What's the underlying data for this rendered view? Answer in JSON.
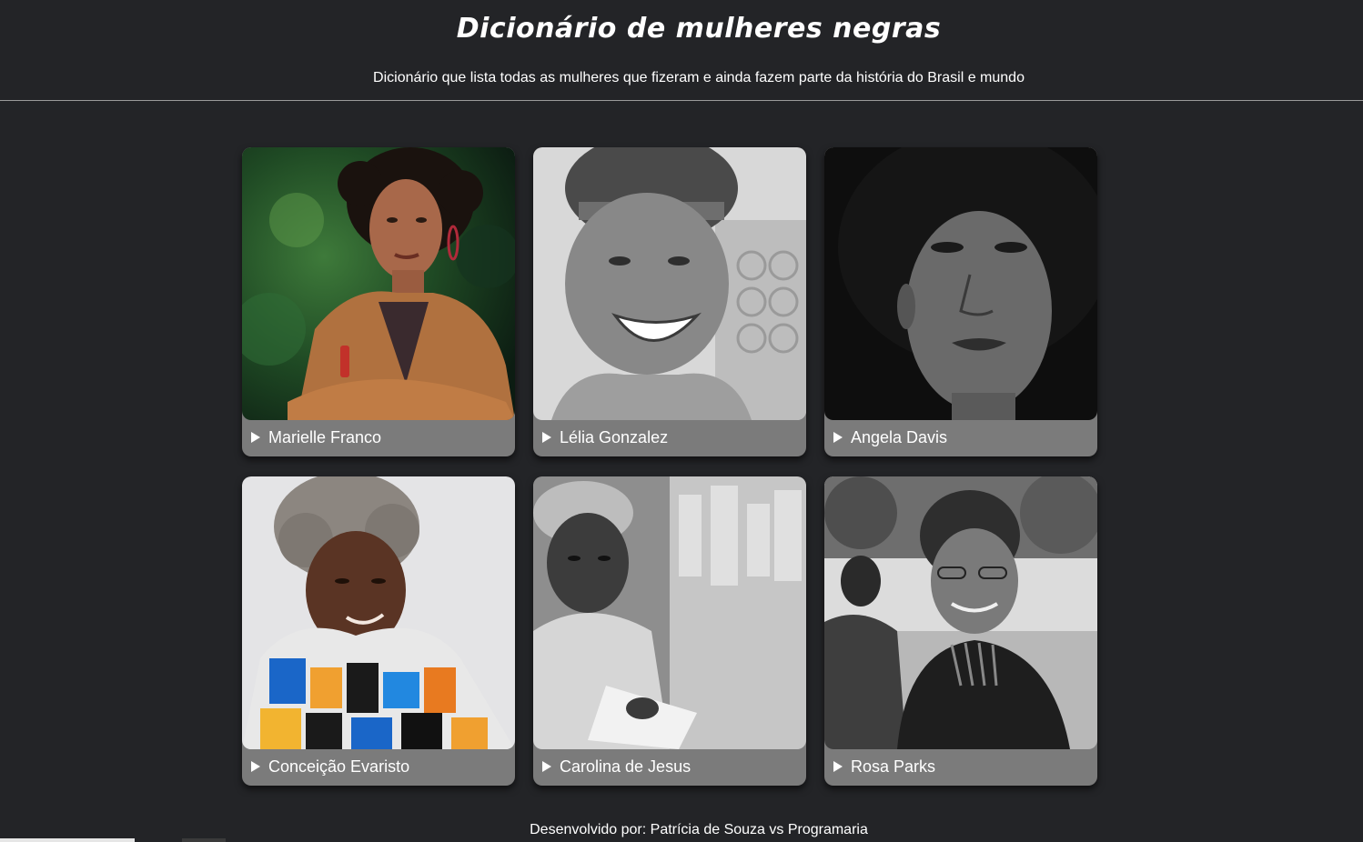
{
  "header": {
    "title": "Dicionário de mulheres negras",
    "subtitle": "Dicionário que lista todas as mulheres que fizeram e ainda fazem parte da história do Brasil e mundo"
  },
  "cards": [
    {
      "name": "Marielle Franco",
      "photo_icon": "portrait-color-photo"
    },
    {
      "name": "Lélia Gonzalez",
      "photo_icon": "portrait-bw-photo"
    },
    {
      "name": "Angela Davis",
      "photo_icon": "portrait-bw-photo"
    },
    {
      "name": "Conceição Evaristo",
      "photo_icon": "portrait-color-photo"
    },
    {
      "name": "Carolina de Jesus",
      "photo_icon": "portrait-bw-photo"
    },
    {
      "name": "Rosa Parks",
      "photo_icon": "portrait-bw-photo"
    }
  ],
  "footer": {
    "text": "Desenvolvido por: Patrícia de Souza vs Programaria"
  },
  "colors": {
    "background": "#232427",
    "card": "#7b7b7b",
    "text": "#ffffff"
  }
}
